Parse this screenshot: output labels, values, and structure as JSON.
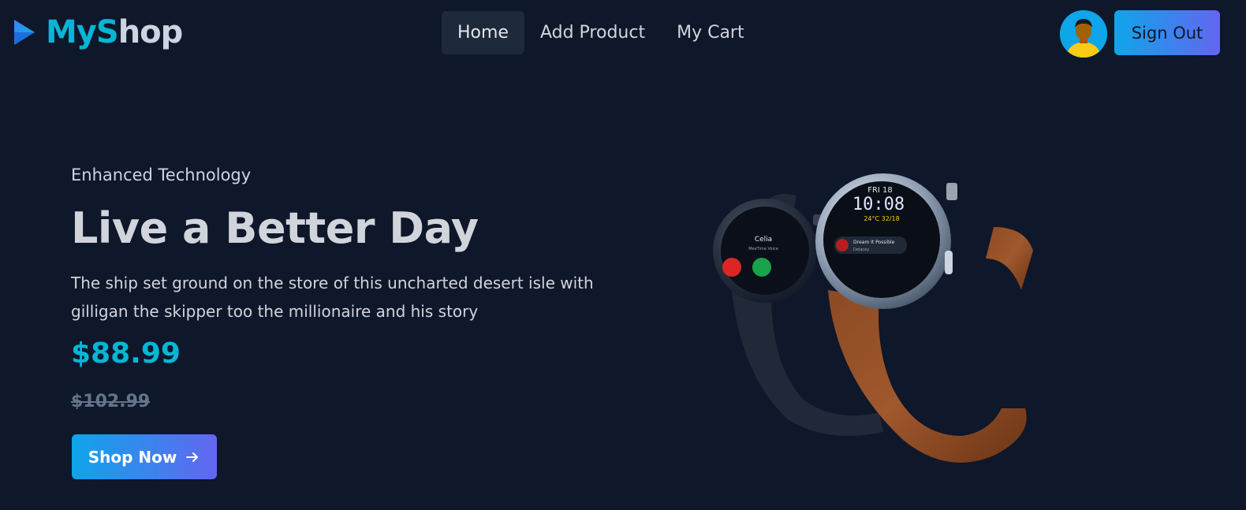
{
  "brand": {
    "name_part1": "My",
    "name_part2": "Shop",
    "icon": "play-triangle-logo-icon"
  },
  "nav": {
    "items": [
      {
        "label": "Home",
        "active": true
      },
      {
        "label": "Add Product",
        "active": false
      },
      {
        "label": "My Cart",
        "active": false
      }
    ],
    "sign_out_label": "Sign Out",
    "avatar": "user-avatar"
  },
  "hero": {
    "eyebrow": "Enhanced Technology",
    "headline": "Live a Better Day",
    "description": "The ship set ground on the store of this uncharted desert isle with gilligan the skipper too the millionaire and his story",
    "price": "$88.99",
    "old_price": "$102.99",
    "cta_label": "Shop Now",
    "cta_icon": "arrow-right-icon",
    "image": {
      "description_icon": "smartwatch-product-image",
      "watch_face_day": "FRI 18",
      "watch_face_time": "10:08",
      "watch_face_temp": "24°C 32/18",
      "watch_face_note": "Dream It Possible",
      "watch_face_note_sub": "Delacey",
      "watch_face_caller": "Celia",
      "watch_face_caller_sub": "MeeTime Voice"
    }
  },
  "colors": {
    "background": "#0f172a",
    "accent": "#06b6d4",
    "gradient_start": "#0ea5e9",
    "gradient_end": "#6366f1",
    "muted": "#64748b"
  }
}
